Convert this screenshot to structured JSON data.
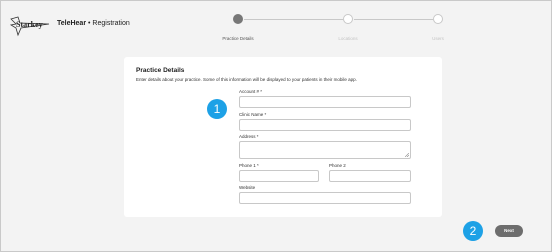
{
  "header": {
    "logo_text": "Starkey",
    "app_name": "TeleHear",
    "separator": "•",
    "section": "Registration"
  },
  "stepper": {
    "steps": [
      {
        "label": "Practice Details",
        "state": "active"
      },
      {
        "label": "Locations",
        "state": "inactive"
      },
      {
        "label": "Users",
        "state": "inactive"
      }
    ]
  },
  "form": {
    "title": "Practice Details",
    "description": "Enter details about your practice. Some of this information will be displayed to your patients in their mobile app.",
    "fields": {
      "account": {
        "label": "Account # *",
        "value": ""
      },
      "clinic_name": {
        "label": "Clinic Name *",
        "value": ""
      },
      "address": {
        "label": "Address *",
        "value": ""
      },
      "phone1": {
        "label": "Phone 1 *",
        "value": ""
      },
      "phone2": {
        "label": "Phone 2",
        "value": ""
      },
      "website": {
        "label": "Website",
        "value": ""
      }
    }
  },
  "annotations": {
    "badge1": "1",
    "badge2": "2"
  },
  "actions": {
    "next_label": "Next"
  },
  "colors": {
    "badge": "#1da1e6",
    "next_button": "#6d6d6d",
    "active_step": "#777777",
    "background": "#f3f3f3"
  }
}
